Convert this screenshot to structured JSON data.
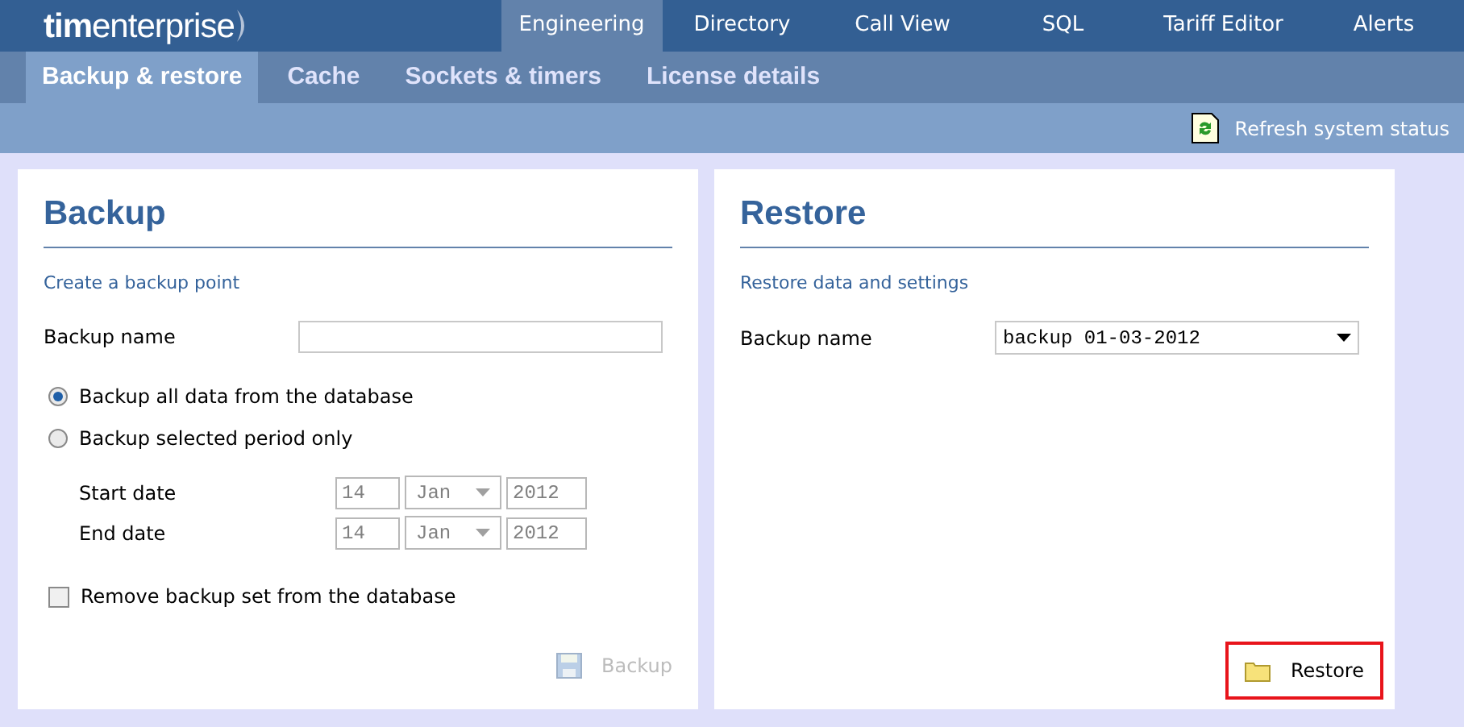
{
  "header": {
    "logo_bold": "tim",
    "logo_light": "enterprise"
  },
  "top_tabs": [
    {
      "label": "Engineering",
      "selected": true
    },
    {
      "label": "Directory",
      "selected": false
    },
    {
      "label": "Call View",
      "selected": false
    },
    {
      "label": "SQL",
      "selected": false
    },
    {
      "label": "Tariff Editor",
      "selected": false
    },
    {
      "label": "Alerts",
      "selected": false
    }
  ],
  "sub_tabs": [
    {
      "label": "Backup & restore",
      "selected": true
    },
    {
      "label": "Cache",
      "selected": false
    },
    {
      "label": "Sockets & timers",
      "selected": false
    },
    {
      "label": "License details",
      "selected": false
    }
  ],
  "toolbar": {
    "refresh": "Refresh system status"
  },
  "backup": {
    "title": "Backup",
    "subtitle": "Create a backup point",
    "name_label": "Backup name",
    "options": [
      {
        "label": "Backup all data from the database",
        "selected": true
      },
      {
        "label": "Backup selected period only",
        "selected": false
      }
    ],
    "dates": [
      {
        "label": "Start date",
        "day": "14",
        "month": "Jan",
        "year": "2012",
        "disabled": true
      },
      {
        "label": "End date",
        "day": "14",
        "month": "Jan",
        "year": "2012",
        "disabled": true
      }
    ],
    "remove": {
      "label": "Remove backup set from the database",
      "checked": false
    },
    "button": {
      "label": "Backup",
      "disabled": true
    }
  },
  "restore": {
    "title": "Restore",
    "subtitle": "Restore data and settings",
    "name_label": "Backup name",
    "name_value": "backup 01-03-2012",
    "button": {
      "label": "Restore",
      "highlighted": true
    }
  }
}
